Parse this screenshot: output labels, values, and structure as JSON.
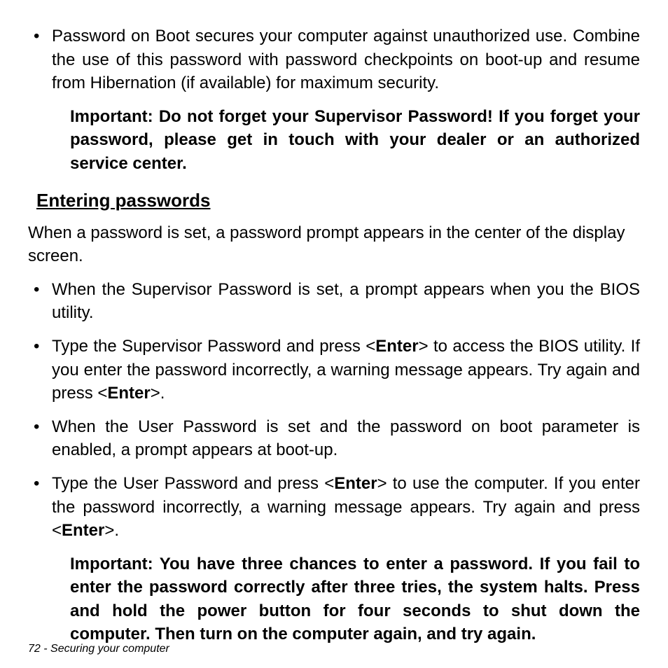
{
  "topList": {
    "item1": "Password on Boot secures your computer against unauthorized use. Combine the use of this password with password checkpoints on boot-up and resume from Hibernation (if available) for maximum security."
  },
  "important1": "Important: Do not forget your Supervisor Password! If you forget your password, please get in touch with your dealer or an authorized service center.",
  "heading": "Entering passwords",
  "intro": "When a password is set, a password prompt appears in the center of the display screen.",
  "list2": {
    "i1": "When the Supervisor Password is set, a prompt appears when you the BIOS utility.",
    "i2a": "Type the Supervisor Password and press <",
    "i2b": "Enter",
    "i2c": "> to access the BIOS utility. If you enter the password incorrectly, a warning message appears. Try again and press <",
    "i2d": "Enter",
    "i2e": ">.",
    "i3": "When the User Password is set and the password on boot parameter is enabled, a prompt appears at boot-up.",
    "i4a": "Type the User Password and press <",
    "i4b": "Enter",
    "i4c": "> to use the computer. If you enter the password incorrectly, a warning message appears. Try again and press <",
    "i4d": "Enter",
    "i4e": ">."
  },
  "important2": "Important: You have three chances to enter a password. If you fail to enter the password correctly after three tries, the system halts. Press and hold the power button for four seconds to shut down the computer. Then turn on the computer again, and try again.",
  "footer": "72 - Securing your computer"
}
